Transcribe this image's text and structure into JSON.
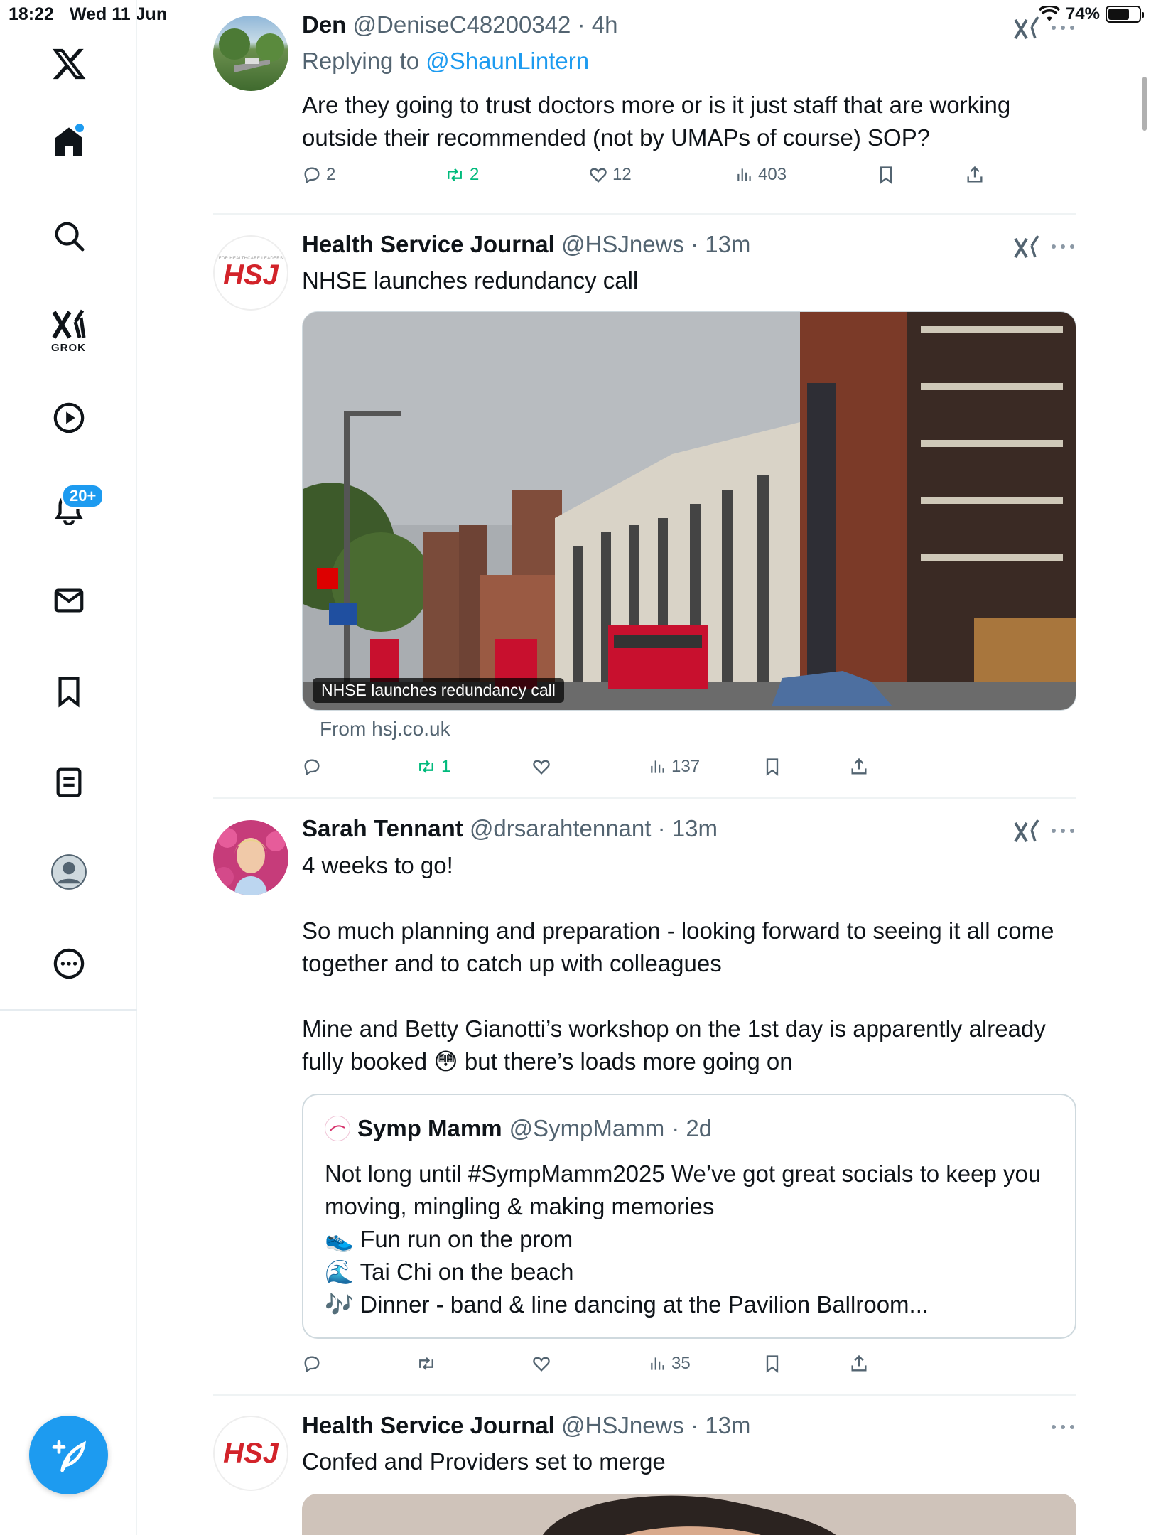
{
  "status_bar": {
    "time": "18:22",
    "date": "Wed 11 Jun",
    "battery": "74%"
  },
  "sidebar": {
    "grok_label": "GROK",
    "notifications_badge": "20+"
  },
  "posts": [
    {
      "name": "Den",
      "handle": "@DeniseC48200342",
      "time": "· 4h",
      "replying_prefix": "Replying to",
      "replying_handle": "@ShaunLintern",
      "text": "Are they going to trust doctors more or is it just staff that are working outside their recommended (not by UMAPs of course) SOP?",
      "replies": "2",
      "reposts": "2",
      "likes": "12",
      "views": "403"
    },
    {
      "name": "Health Service Journal",
      "handle": "@HSJnews",
      "time": "· 13m",
      "text": "NHSE launches redundancy call",
      "avatar_text": "HSJ",
      "avatar_subtext": "FOR HEALTHCARE LEADERS",
      "media_caption": "NHSE launches redundancy call",
      "from": "From hsj.co.uk",
      "reposts": "1",
      "views": "137"
    },
    {
      "name": "Sarah Tennant",
      "handle": "@drsarahtennant",
      "time": "· 13m",
      "text": "4 weeks to go!\n\nSo much planning and preparation - looking forward to seeing it all come together and to catch up with colleagues\n\nMine and Betty Gianotti’s workshop on the 1st day is apparently already fully booked 😳 but there’s loads more going on",
      "quote": {
        "name": "Symp Mamm",
        "handle": "@SympMamm",
        "time": "· 2d",
        "text": "Not long until #SympMamm2025 We’ve got great socials to keep you moving, mingling & making memories\n👟 Fun run on the prom\n🌊 Tai Chi on the beach\n🎶 Dinner - band & line dancing at the Pavilion Ballroom..."
      },
      "views": "35"
    },
    {
      "name": "Health Service Journal",
      "handle": "@HSJnews",
      "time": "· 13m",
      "text": "Confed and Providers set to merge",
      "avatar_text": "HSJ"
    }
  ]
}
